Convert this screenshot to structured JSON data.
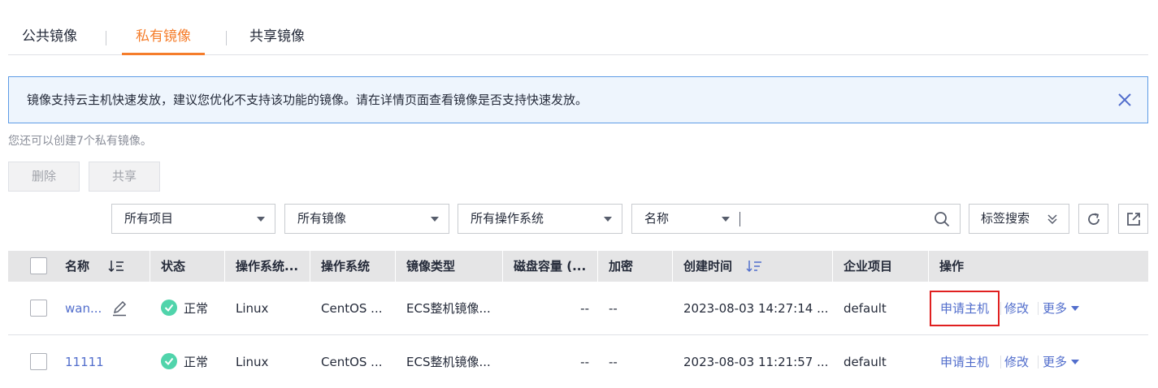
{
  "tabs": [
    {
      "label": "公共镜像",
      "active": false
    },
    {
      "label": "私有镜像",
      "active": true
    },
    {
      "label": "共享镜像",
      "active": false
    }
  ],
  "notice": {
    "text": "镜像支持云主机快速发放，建议您优化不支持该功能的镜像。请在详情页面查看镜像是否支持快速发放。"
  },
  "quota_text": "您还可以创建7个私有镜像。",
  "actions": {
    "delete_label": "删除",
    "share_label": "共享"
  },
  "filters": {
    "project": "所有项目",
    "image": "所有镜像",
    "os": "所有操作系统",
    "search_attr": "名称",
    "search_value": "",
    "tag_search": "标签搜索"
  },
  "table": {
    "columns": [
      "名称",
      "状态",
      "操作系统...",
      "操作系统",
      "镜像类型",
      "磁盘容量 (...",
      "加密",
      "创建时间",
      "企业项目",
      "操作"
    ],
    "rows": [
      {
        "name": "wan...",
        "status": "正常",
        "os_type": "Linux",
        "os": "CentOS ...",
        "image_type": "ECS整机镜像...",
        "disk": "--",
        "encrypted": "--",
        "created": "2023-08-03 14:27:14 ...",
        "project": "default",
        "op_apply": "申请主机",
        "op_modify": "修改",
        "op_more": "更多"
      },
      {
        "name": "11111",
        "status": "正常",
        "os_type": "Linux",
        "os": "CentOS ...",
        "image_type": "ECS整机镜像...",
        "disk": "--",
        "encrypted": "--",
        "created": "2023-08-03 11:21:57 ...",
        "project": "default",
        "op_apply": "申请主机",
        "op_modify": "修改",
        "op_more": "更多"
      }
    ]
  },
  "colors": {
    "accent": "#f57d2b",
    "link": "#526ecc",
    "status_ok": "#50d4ab",
    "highlight": "#e02020",
    "notice_bg": "#eef5fd",
    "notice_border": "#5e9ce6"
  },
  "icons": [
    "close-icon",
    "search-icon",
    "double-chevron-down-icon",
    "refresh-icon",
    "export-icon",
    "sort-icon",
    "edit-icon",
    "check-icon",
    "caret-down-icon"
  ]
}
